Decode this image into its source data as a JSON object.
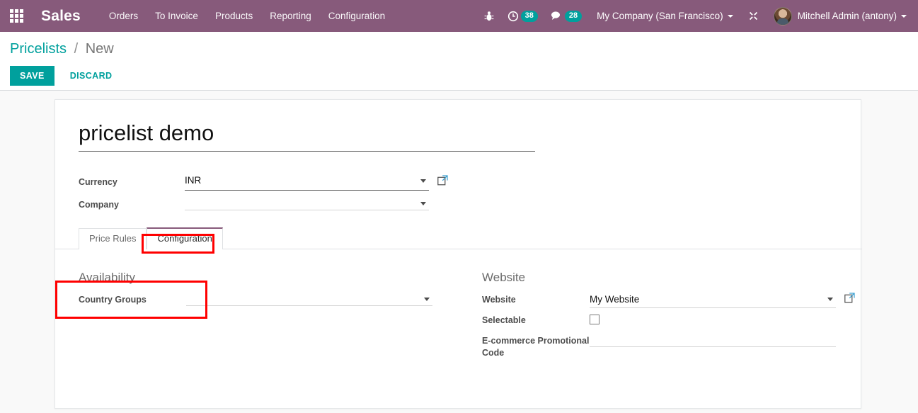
{
  "navbar": {
    "apps_icon": "apps-grid-icon",
    "brand": "Sales",
    "menu": [
      {
        "label": "Orders"
      },
      {
        "label": "To Invoice"
      },
      {
        "label": "Products"
      },
      {
        "label": "Reporting"
      },
      {
        "label": "Configuration"
      }
    ],
    "bug_icon": "bug-icon",
    "activities": {
      "icon": "clock-icon",
      "count": "38"
    },
    "messages": {
      "icon": "chat-bubble-icon",
      "count": "28"
    },
    "company": "My Company (San Francisco)",
    "tools_icon": "wrench-icon",
    "user": "Mitchell Admin (antony)",
    "accent_color": "#875A7B",
    "badge_color": "#00A09D"
  },
  "control_panel": {
    "breadcrumb_root": "Pricelists",
    "breadcrumb_separator": "/",
    "breadcrumb_current": "New",
    "save_label": "SAVE",
    "discard_label": "DISCARD",
    "primary_color": "#00A09D"
  },
  "form": {
    "title": "pricelist demo",
    "fields": [
      {
        "label": "Currency",
        "value": "INR",
        "has_dropdown": true,
        "has_external_link": true,
        "filled": true
      },
      {
        "label": "Company",
        "value": "",
        "has_dropdown": true,
        "has_external_link": false,
        "filled": false
      }
    ]
  },
  "notebook": {
    "tabs": [
      {
        "label": "Price Rules",
        "active": false
      },
      {
        "label": "Configuration",
        "active": true
      }
    ]
  },
  "configuration_tab": {
    "left_group": {
      "title": "Availability",
      "fields": [
        {
          "label": "Country Groups",
          "value": "",
          "type": "many2many",
          "has_dropdown": true
        }
      ]
    },
    "right_group": {
      "title": "Website",
      "fields": [
        {
          "label": "Website",
          "value": "My Website",
          "type": "many2one",
          "has_dropdown": true,
          "has_external_link": true
        },
        {
          "label": "Selectable",
          "value": "",
          "type": "checkbox",
          "checked": false
        },
        {
          "label": "E-commerce Promotional Code",
          "value": "",
          "type": "char",
          "has_dropdown": false
        }
      ]
    }
  },
  "annotations": [
    {
      "name": "configuration-tab-highlight",
      "color": "#ff0000"
    },
    {
      "name": "availability-group-highlight",
      "color": "#ff0000"
    }
  ]
}
